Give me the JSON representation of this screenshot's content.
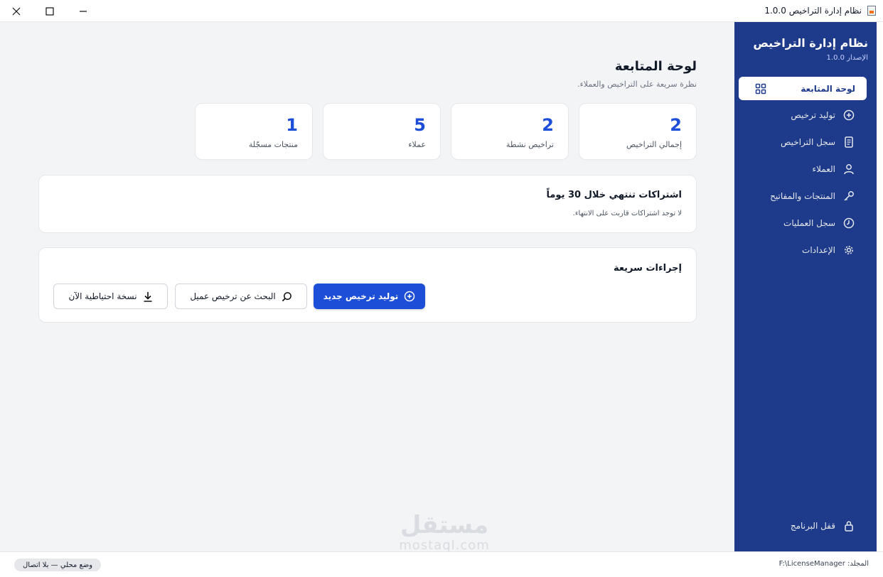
{
  "window": {
    "title": "نظام إدارة التراخيص 1.0.0"
  },
  "sidebar": {
    "brand": "نظام إدارة التراخيص",
    "version": "الإصدار 1.0.0",
    "items": [
      {
        "label": "لوحة المتابعة",
        "icon": "dashboard-grid-icon"
      },
      {
        "label": "توليد ترخيص",
        "icon": "plus-circle-icon"
      },
      {
        "label": "سجل التراخيص",
        "icon": "document-icon"
      },
      {
        "label": "العملاء",
        "icon": "user-icon"
      },
      {
        "label": "المنتجات والمفاتيح",
        "icon": "key-icon"
      },
      {
        "label": "سجل العمليات",
        "icon": "clock-icon"
      },
      {
        "label": "الإعدادات",
        "icon": "gear-icon"
      }
    ],
    "lock_label": "قفل البرنامج"
  },
  "main": {
    "title": "لوحة المتابعة",
    "subtitle": "نظرة سريعة على التراخيص والعملاء.",
    "stats": [
      {
        "value": "2",
        "label": "إجمالي التراخيص"
      },
      {
        "value": "2",
        "label": "تراخيص نشطة"
      },
      {
        "value": "5",
        "label": "عملاء"
      },
      {
        "value": "1",
        "label": "منتجات مسجّلة"
      }
    ],
    "expiring": {
      "title": "اشتراكات تنتهي خلال 30 يوماً",
      "text": "لا توجد اشتراكات قاربت على الانتهاء."
    },
    "quick_actions": {
      "title": "إجراءات سريعة",
      "new_license": "توليد ترخيص جديد",
      "search_license": "البحث عن ترخيص عميل",
      "backup": "نسخة احتياطية الآن"
    }
  },
  "watermark": {
    "top": "مستقل",
    "bottom": "mostaql.com"
  },
  "status": {
    "mode": "وضع محلي — بلا اتصال",
    "folder": "المجلد: F:\\LicenseManager"
  },
  "colors": {
    "sidebar": "#1e3a8a",
    "accent": "#1d4ed8",
    "background": "#f3f4f6"
  }
}
